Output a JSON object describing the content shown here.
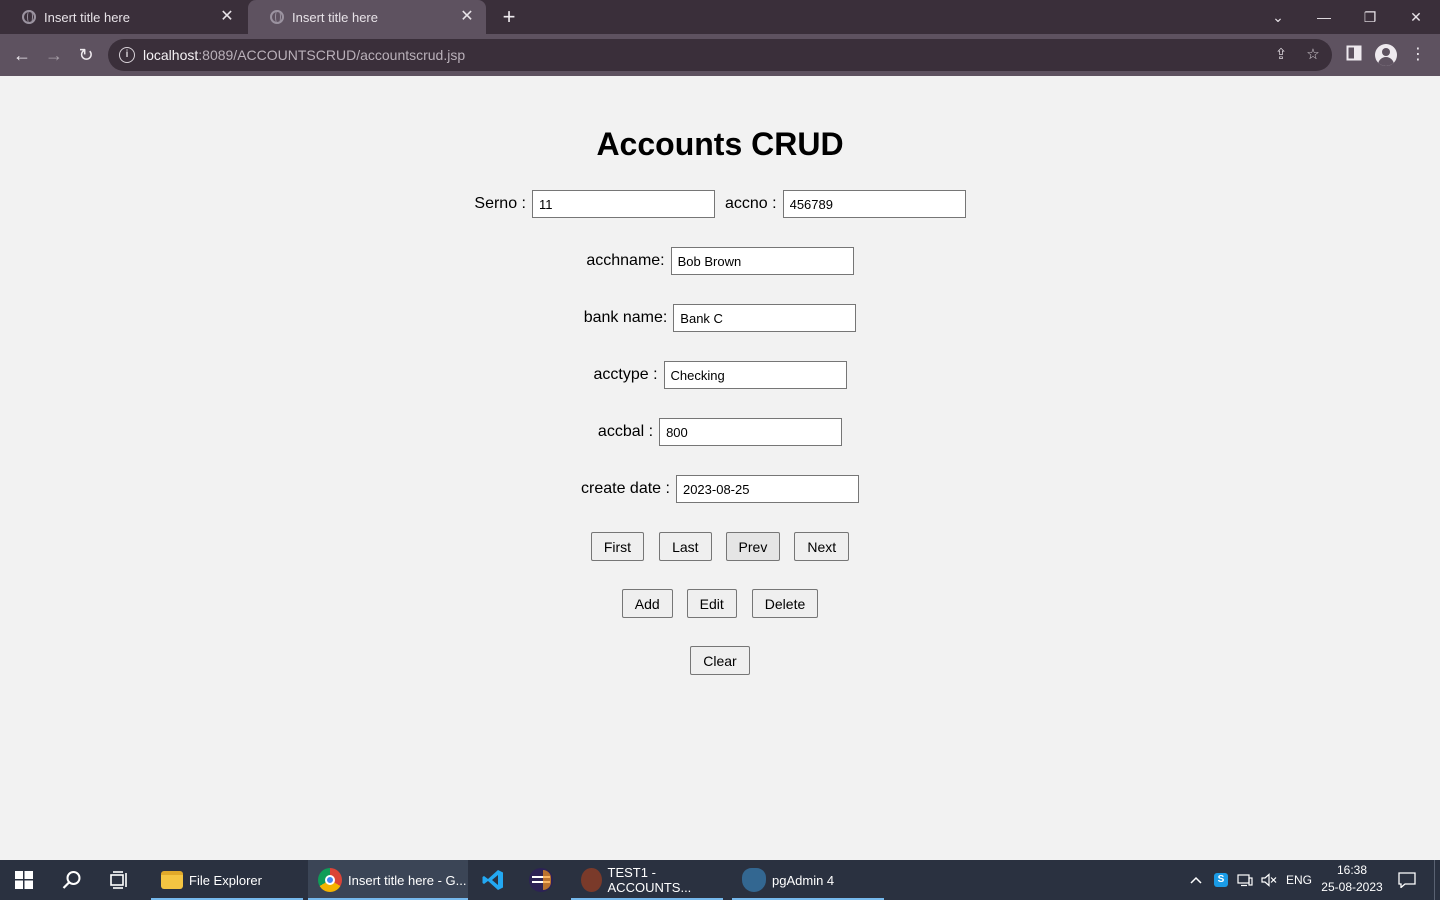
{
  "browser": {
    "tabs": [
      {
        "title": "Insert title here",
        "active": false
      },
      {
        "title": "Insert title here",
        "active": true
      }
    ],
    "new_tab_label": "+",
    "window_controls": {
      "dropdown": "⌄",
      "minimize": "—",
      "restore": "❐",
      "close": "✕"
    },
    "nav": {
      "back": "←",
      "forward": "→",
      "reload": "↻"
    },
    "url_host": "localhost",
    "url_rest": ":8089/ACCOUNTSCRUD/accountscrud.jsp",
    "icons": [
      "share-icon",
      "bookmark-star-icon",
      "sidebar-icon",
      "profile-icon",
      "menu-icon"
    ]
  },
  "form": {
    "title": "Accounts CRUD",
    "serno_label": "Serno :",
    "serno_value": "11",
    "accno_label": "accno :",
    "accno_value": "456789",
    "acchname_label": "acchname:",
    "acchname_value": "Bob Brown",
    "bankname_label": "bank name:",
    "bankname_value": "Bank C",
    "acctype_label": "acctype :",
    "acctype_value": "Checking",
    "accbal_label": "accbal :",
    "accbal_value": "800",
    "createdate_label": "create date :",
    "createdate_value": "2023-08-25",
    "buttons": {
      "first": "First",
      "last": "Last",
      "prev": "Prev",
      "next": "Next",
      "add": "Add",
      "edit": "Edit",
      "delete": "Delete",
      "clear": "Clear"
    }
  },
  "taskbar": {
    "items": [
      {
        "label": "File Explorer",
        "icon": "file-explorer-icon"
      },
      {
        "label": "Insert title here - G...",
        "icon": "chrome-icon",
        "active": true
      },
      {
        "label": "",
        "icon": "vscode-icon"
      },
      {
        "label": "",
        "icon": "eclipse-icon"
      },
      {
        "label": "TEST1 - ACCOUNTS...",
        "icon": "app-icon"
      },
      {
        "label": "pgAdmin 4",
        "icon": "pgadmin-icon"
      }
    ],
    "tray": {
      "language": "ENG",
      "time": "16:38",
      "date": "25-08-2023"
    }
  }
}
